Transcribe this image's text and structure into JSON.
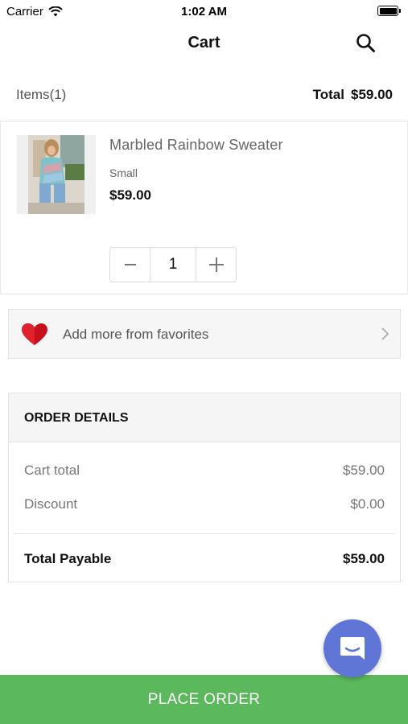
{
  "status_bar": {
    "carrier": "Carrier",
    "time": "1:02 AM"
  },
  "header": {
    "title": "Cart",
    "search_icon": "search-icon"
  },
  "summary": {
    "items_label": "Items",
    "items_count": "(1)",
    "total_label": "Total",
    "total_value": "$59.00"
  },
  "cart_item": {
    "name": "Marbled Rainbow Sweater",
    "size": "Small",
    "price": "$59.00",
    "quantity": "1",
    "minus_icon": "minus-icon",
    "plus_icon": "plus-icon"
  },
  "favorites": {
    "label": "Add more from favorites",
    "icon": "heart-icon",
    "chevron": "chevron-right-icon"
  },
  "order_details": {
    "title": "ORDER DETAILS",
    "lines": [
      {
        "label": "Cart total",
        "value": "$59.00"
      },
      {
        "label": "Discount",
        "value": "$0.00"
      }
    ],
    "payable_label": "Total Payable",
    "payable_value": "$59.00"
  },
  "chat": {
    "icon": "chat-bubble-icon"
  },
  "footer": {
    "place_order_label": "PLACE ORDER"
  },
  "colors": {
    "accent_green": "#5cb85c",
    "chat_blue": "#5f76d6",
    "heart_red": "#c8101c"
  }
}
